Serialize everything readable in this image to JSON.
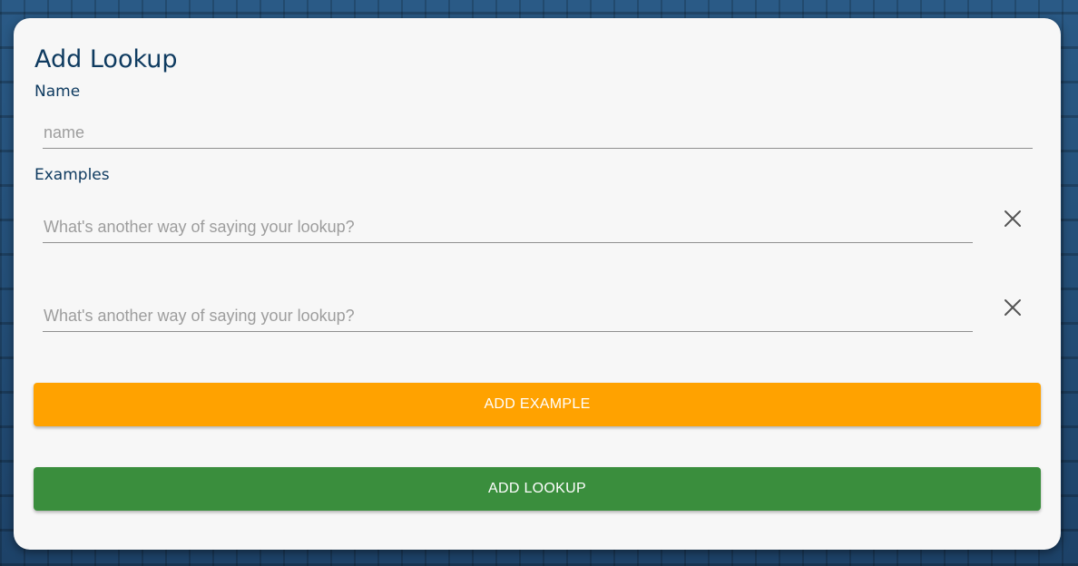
{
  "dialog": {
    "title": "Add Lookup",
    "name_section": {
      "label": "Name",
      "input": {
        "value": "",
        "placeholder": "name"
      }
    },
    "examples_section": {
      "label": "Examples",
      "examples": [
        {
          "value": "",
          "placeholder": "What's another way of saying your lookup?",
          "remove_icon": "close-icon"
        },
        {
          "value": "",
          "placeholder": "What's another way of saying your lookup?",
          "remove_icon": "close-icon"
        }
      ]
    },
    "buttons": {
      "add_example": {
        "label": "ADD EXAMPLE",
        "color": "#ffa200"
      },
      "add_lookup": {
        "label": "ADD LOOKUP",
        "color": "#3a8e3d"
      }
    }
  },
  "colors": {
    "title_text": "#0f3b60",
    "dialog_background": "#f7f7f7",
    "page_background": "#21496e"
  }
}
